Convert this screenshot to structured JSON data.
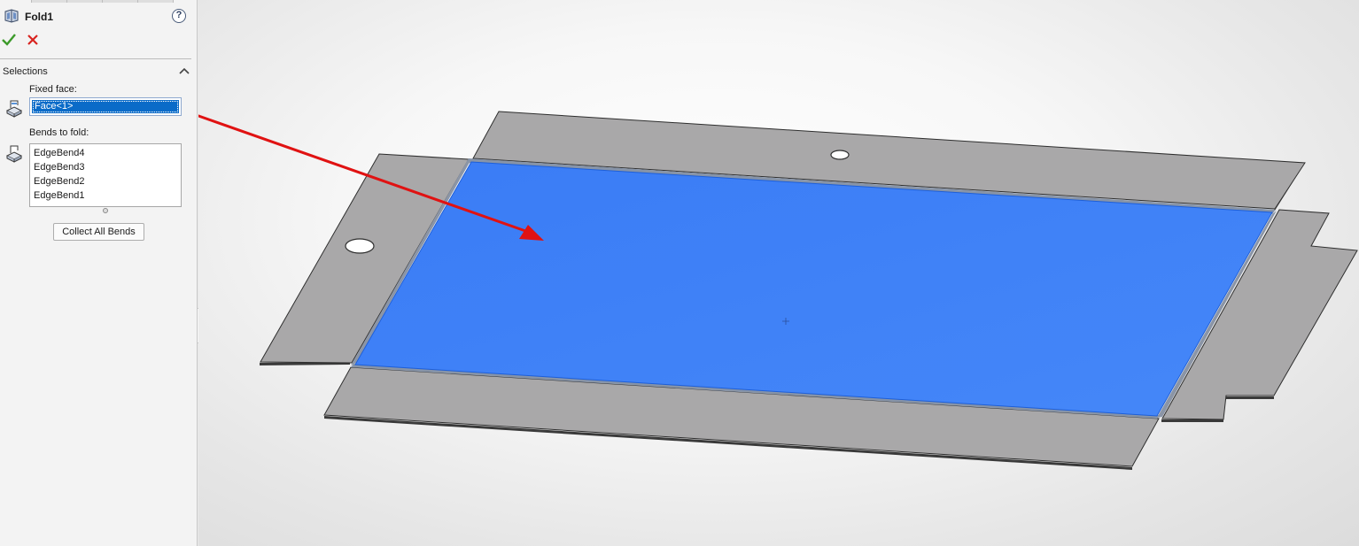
{
  "feature": {
    "title": "Fold1",
    "help_glyph": "?",
    "icon": "fold-feature-icon"
  },
  "actions": {
    "ok_icon": "green-checkmark-icon",
    "cancel_icon": "red-x-icon"
  },
  "selections": {
    "section_title": "Selections",
    "fixed_face_label": "Fixed face:",
    "fixed_face_value": "Face<1>",
    "bends_label": "Bends to fold:",
    "bends": [
      "EdgeBend4",
      "EdgeBend3",
      "EdgeBend2",
      "EdgeBend1"
    ],
    "collect_button_label": "Collect All Bends"
  },
  "colors": {
    "selected_face": "#3d7ff7",
    "sheet_metal": "#a9a8a9",
    "arrow": "#e01212",
    "selection_highlight": "#0a6bc8"
  }
}
